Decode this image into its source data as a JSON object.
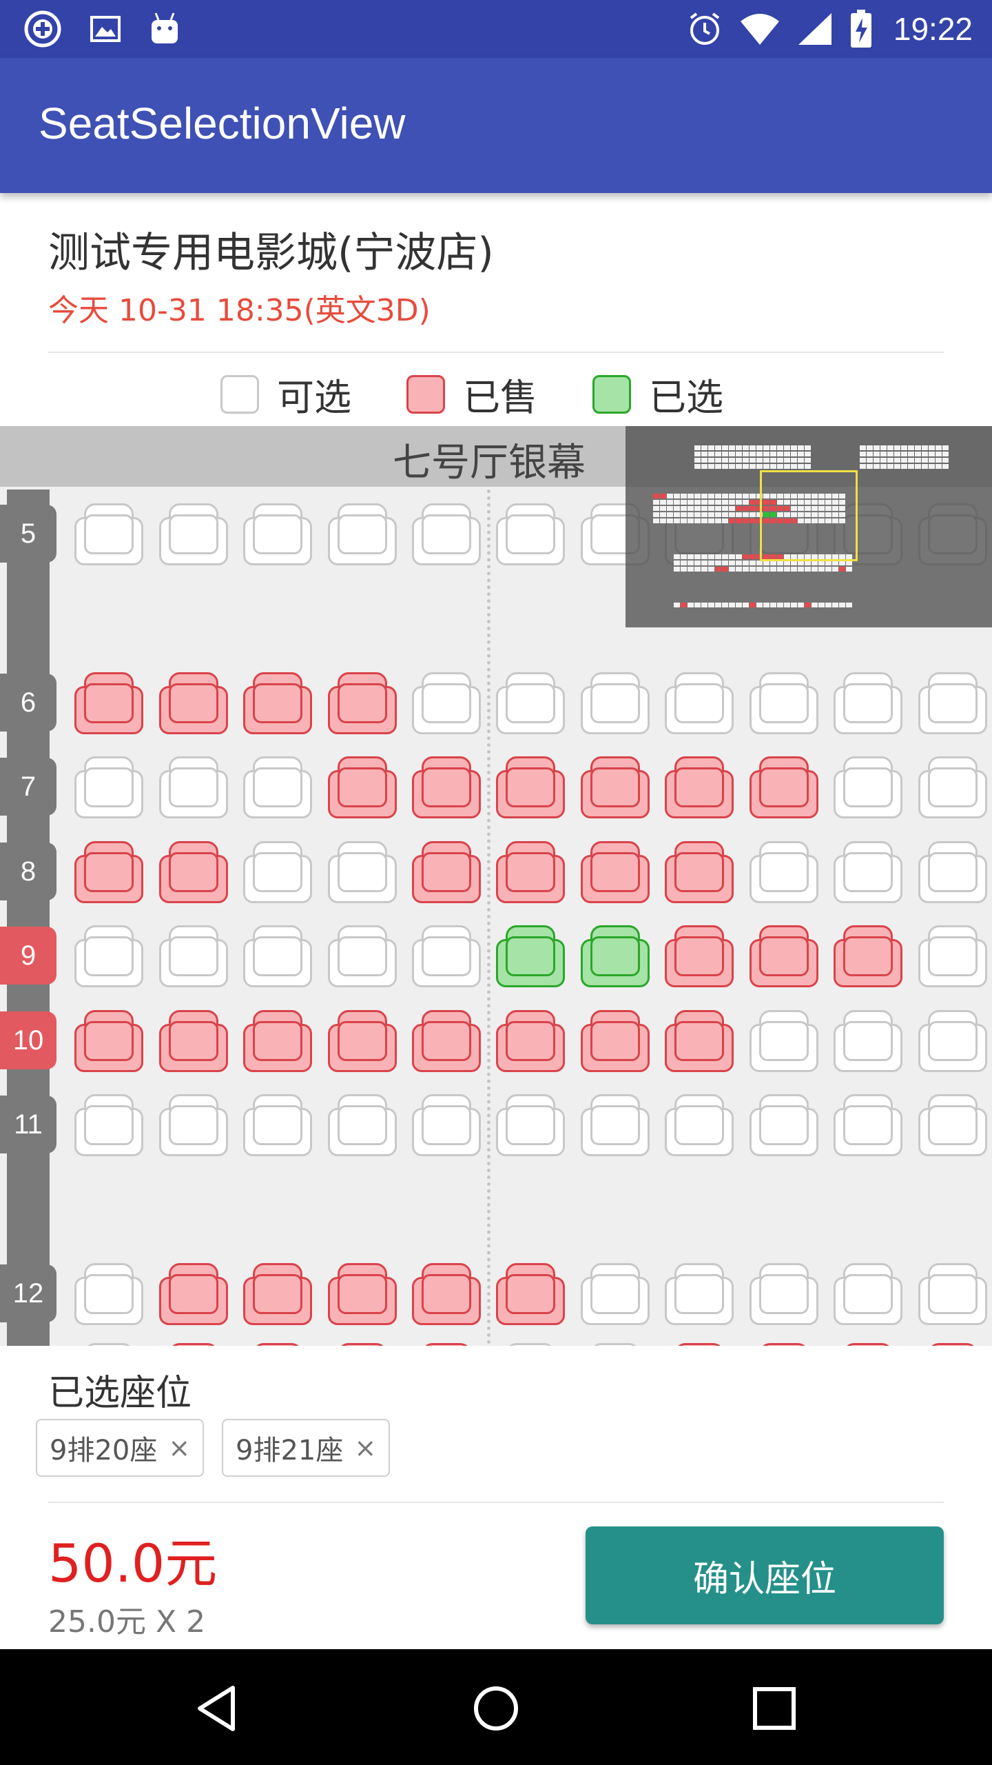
{
  "status_bar": {
    "time": "19:22",
    "left_icons": [
      "add-circle-icon",
      "image-icon",
      "android-icon"
    ],
    "right_icons": [
      "alarm-icon",
      "wifi-icon",
      "signal-icon",
      "battery-charging-icon"
    ]
  },
  "app_bar": {
    "title": "SeatSelectionView"
  },
  "cinema": {
    "name": "测试专用电影城(宁波店)",
    "showtime": "今天 10-31 18:35(英文3D)"
  },
  "legend": [
    {
      "state": "available",
      "label": "可选"
    },
    {
      "state": "sold",
      "label": "已售"
    },
    {
      "state": "selected",
      "label": "已选"
    }
  ],
  "screen": {
    "label": "七号厅银幕"
  },
  "seat_rows": [
    {
      "label": "5",
      "highlight": false,
      "seats": [
        "a",
        "a",
        "a",
        "a",
        "a",
        "a",
        "a",
        "a",
        "a",
        "a",
        "a"
      ]
    },
    {
      "label": "6",
      "highlight": false,
      "seats": [
        "s",
        "s",
        "s",
        "s",
        "a",
        "a",
        "a",
        "a",
        "a",
        "a",
        "a"
      ]
    },
    {
      "label": "7",
      "highlight": false,
      "seats": [
        "a",
        "a",
        "a",
        "s",
        "s",
        "s",
        "s",
        "s",
        "s",
        "a",
        "a"
      ]
    },
    {
      "label": "8",
      "highlight": false,
      "seats": [
        "s",
        "s",
        "a",
        "a",
        "s",
        "s",
        "s",
        "s",
        "a",
        "a",
        "a"
      ]
    },
    {
      "label": "9",
      "highlight": true,
      "seats": [
        "a",
        "a",
        "a",
        "a",
        "a",
        "g",
        "g",
        "s",
        "s",
        "s",
        "a"
      ]
    },
    {
      "label": "10",
      "highlight": true,
      "seats": [
        "s",
        "s",
        "s",
        "s",
        "s",
        "s",
        "s",
        "s",
        "a",
        "a",
        "a"
      ]
    },
    {
      "label": "11",
      "highlight": false,
      "seats": [
        "a",
        "a",
        "a",
        "a",
        "a",
        "a",
        "a",
        "a",
        "a",
        "a",
        "a"
      ]
    },
    {
      "label": "12",
      "highlight": false,
      "seats": [
        "a",
        "s",
        "s",
        "s",
        "s",
        "s",
        "a",
        "a",
        "a",
        "a",
        "a"
      ]
    }
  ],
  "selected_section": {
    "title": "已选座位",
    "seats": [
      {
        "label": "9排20座",
        "remove": "×"
      },
      {
        "label": "9排21座",
        "remove": "×"
      }
    ]
  },
  "price": {
    "total": "50.0元",
    "detail": "25.0元 X 2"
  },
  "confirm_button": {
    "label": "确认座位"
  },
  "nav_bar": {
    "icons": [
      "back-icon",
      "home-icon",
      "recents-icon"
    ]
  },
  "colors": {
    "status_bar": "#3343a8",
    "app_bar": "#3f51b5",
    "sold": "#f9b3b6",
    "selected": "#a6e3a6",
    "price": "#e02020",
    "confirm": "#259089"
  }
}
